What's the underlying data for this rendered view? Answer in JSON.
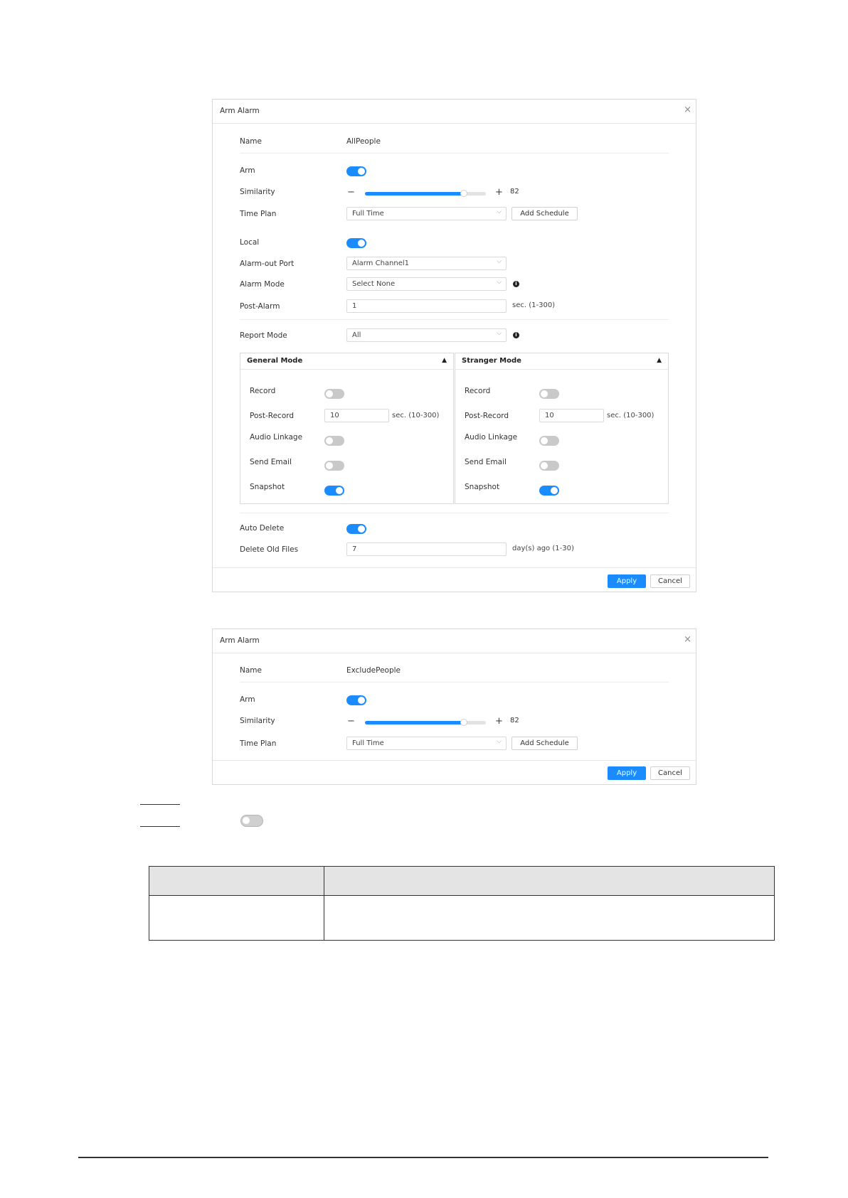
{
  "dialog1": {
    "title": "Arm Alarm",
    "close": "×",
    "name_label": "Name",
    "name_value": "AllPeople",
    "arm_label": "Arm",
    "arm_on": true,
    "similarity_label": "Similarity",
    "similarity_minus": "−",
    "similarity_plus": "+",
    "similarity_value": "82",
    "similarity_fill_percent": 82,
    "time_plan_label": "Time Plan",
    "time_plan_value": "Full Time",
    "add_schedule": "Add Schedule",
    "local_label": "Local",
    "local_on": true,
    "alarm_out_label": "Alarm-out Port",
    "alarm_out_value": "Alarm Channel1",
    "alarm_mode_label": "Alarm Mode",
    "alarm_mode_value": "Select None",
    "post_alarm_label": "Post-Alarm",
    "post_alarm_value": "1",
    "post_alarm_hint": "sec. (1-300)",
    "report_mode_label": "Report Mode",
    "report_mode_value": "All",
    "general_mode": {
      "title": "General Mode",
      "record_label": "Record",
      "record_on": false,
      "post_record_label": "Post-Record",
      "post_record_value": "10",
      "post_record_hint": "sec. (10-300)",
      "audio_label": "Audio Linkage",
      "audio_on": false,
      "email_label": "Send Email",
      "email_on": false,
      "snapshot_label": "Snapshot",
      "snapshot_on": true
    },
    "stranger_mode": {
      "title": "Stranger Mode",
      "record_label": "Record",
      "record_on": false,
      "post_record_label": "Post-Record",
      "post_record_value": "10",
      "post_record_hint": "sec. (10-300)",
      "audio_label": "Audio Linkage",
      "audio_on": false,
      "email_label": "Send Email",
      "email_on": false,
      "snapshot_label": "Snapshot",
      "snapshot_on": true
    },
    "auto_delete_label": "Auto Delete",
    "auto_delete_on": true,
    "delete_old_label": "Delete Old Files",
    "delete_old_value": "7",
    "delete_old_hint": "day(s) ago (1-30)",
    "apply": "Apply",
    "cancel": "Cancel"
  },
  "dialog2": {
    "title": "Arm Alarm",
    "close": "×",
    "name_label": "Name",
    "name_value": "ExcludePeople",
    "arm_label": "Arm",
    "arm_on": true,
    "similarity_label": "Similarity",
    "similarity_minus": "−",
    "similarity_plus": "+",
    "similarity_value": "82",
    "similarity_fill_percent": 82,
    "time_plan_label": "Time Plan",
    "time_plan_value": "Full Time",
    "add_schedule": "Add Schedule",
    "apply": "Apply",
    "cancel": "Cancel"
  },
  "standalone_toggle_on": false,
  "icons": {
    "chevron": "chevron-down-icon",
    "info": "info-icon",
    "caret": "caret-up-icon",
    "close": "close-icon"
  },
  "colors": {
    "accent": "#1a8cff",
    "toggle_off": "#c9c9c9"
  }
}
